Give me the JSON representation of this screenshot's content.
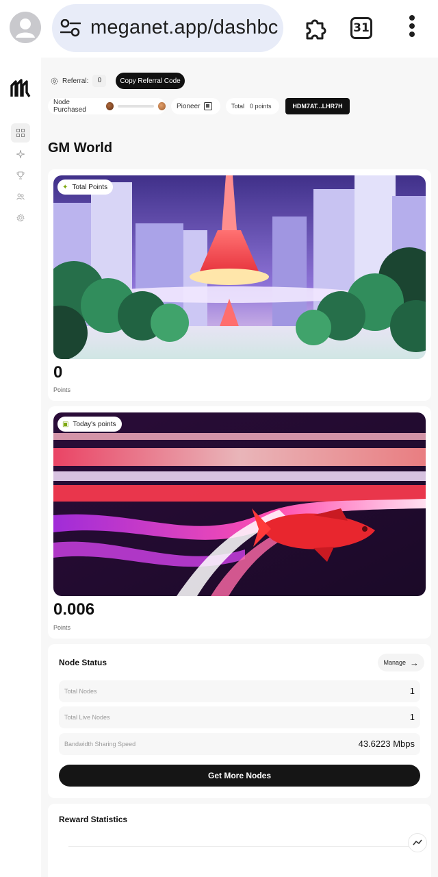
{
  "browser": {
    "url_text": "meganet.app/dashbc",
    "tab_count": "31"
  },
  "sidebar": {
    "items": [
      {
        "icon": "grid-icon"
      },
      {
        "icon": "sparkle-icon"
      },
      {
        "icon": "trophy-icon"
      },
      {
        "icon": "users-icon"
      },
      {
        "icon": "settings-icon"
      }
    ]
  },
  "topbar": {
    "referral_label": "Referral:",
    "referral_count": "0",
    "copy_button": "Copy Referral Code",
    "node_purchased_label": "Node Purchased",
    "tier_label": "Pioneer",
    "total_label": "Total",
    "total_points": "0 points",
    "wallet": "HDM7AT...LHR7H"
  },
  "page": {
    "title": "GM World"
  },
  "total_points_card": {
    "badge": "Total Points",
    "value": "0",
    "unit": "Points"
  },
  "today_points_card": {
    "badge": "Today's points",
    "value": "0.006",
    "unit": "Points"
  },
  "node_status": {
    "title": "Node Status",
    "manage_label": "Manage",
    "rows": [
      {
        "label": "Total Nodes",
        "value": "1"
      },
      {
        "label": "Total Live Nodes",
        "value": "1"
      },
      {
        "label": "Bandwidth Sharing Speed",
        "value": "43.6223 Mbps"
      }
    ],
    "cta": "Get More Nodes"
  },
  "reward_statistics": {
    "title": "Reward Statistics"
  },
  "colors": {
    "accent_dark": "#111111",
    "page_bg": "#f7f7f7",
    "url_bar": "#e8ecf8"
  }
}
